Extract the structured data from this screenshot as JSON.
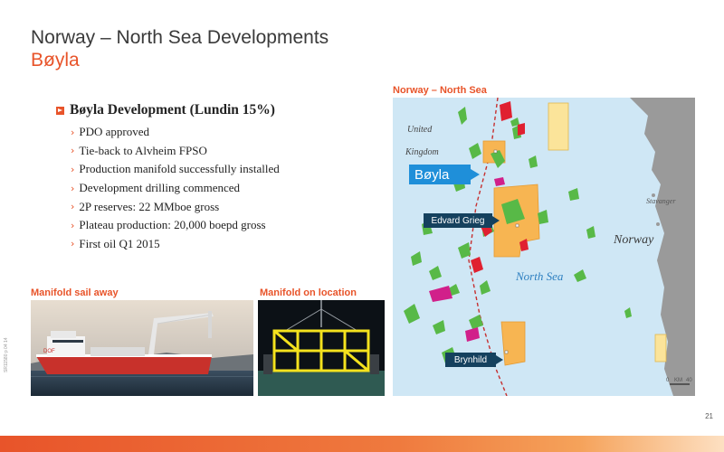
{
  "header": {
    "title": "Norway – North Sea Developments",
    "subtitle": "Bøyla"
  },
  "bullets": {
    "main": "Bøyla Development (Lundin 15%)",
    "items": [
      "PDO approved",
      "Tie-back to Alvheim FPSO",
      "Production manifold successfully installed",
      "Development drilling commenced",
      "2P reserves: 22 MMboe gross",
      "Plateau production: 20,000 boepd gross",
      "First oil Q1 2015"
    ]
  },
  "photos": {
    "left_caption": "Manifold sail away",
    "right_caption": "Manifold on location"
  },
  "map": {
    "title": "Norway – North Sea",
    "labels": {
      "united": "United",
      "kingdom": "Kingdom",
      "boyla": "Bøyla",
      "edvard_grieg": "Edvard Grieg",
      "stavanger": "Stavanger",
      "norway": "Norway",
      "north_sea": "North Sea",
      "brynhild": "Brynhild",
      "scale_0": "0",
      "scale_unit": "KM",
      "scale_40": "40"
    },
    "colors": {
      "sea": "#cfe7f5",
      "land": "#9a9a9a",
      "license_green": "#58b947",
      "license_red": "#e02030",
      "license_magenta": "#d1208a",
      "lundin_orange": "#f7b552",
      "lundin_yellow": "#fbe49a",
      "callout_blue": "#1f8fd9",
      "callout_navy": "#15415e"
    }
  },
  "page": {
    "number": "21",
    "doc_id": "SR11580 p 04 14"
  }
}
